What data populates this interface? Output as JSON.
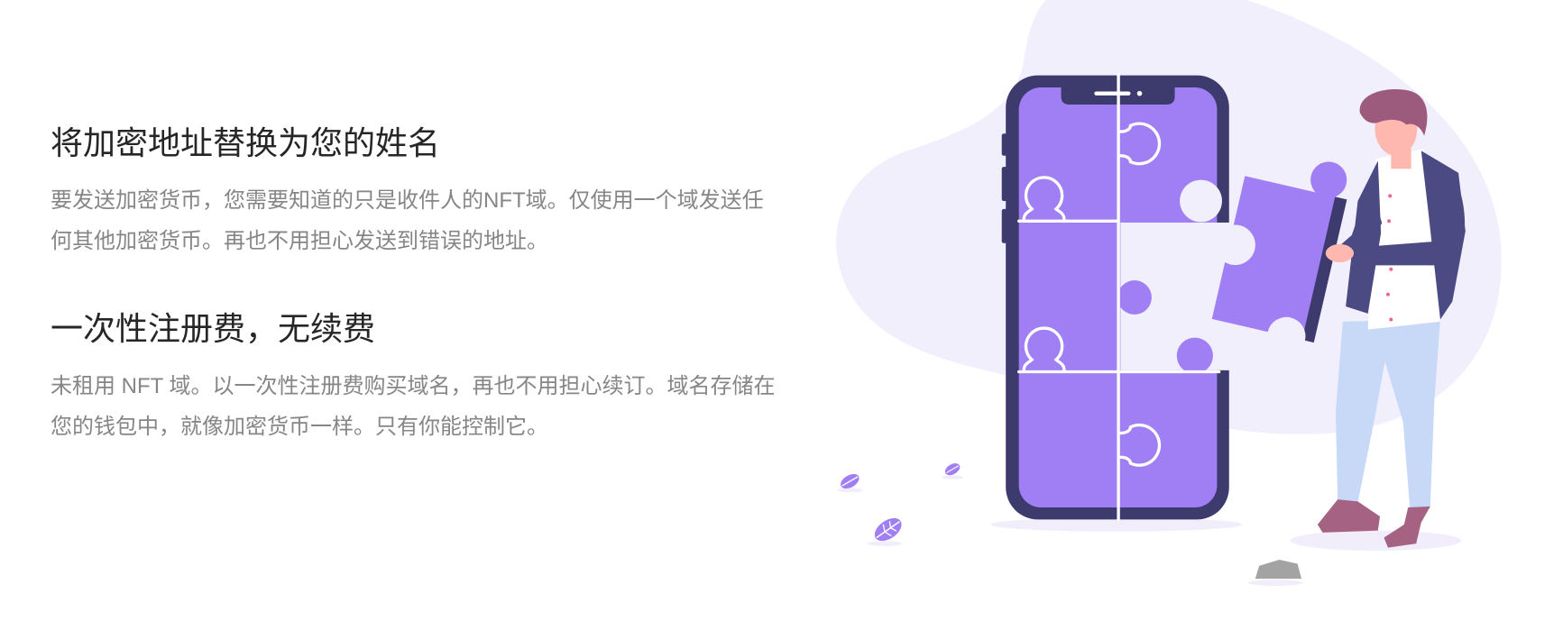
{
  "features": [
    {
      "title": "将加密地址替换为您的姓名",
      "lines": [
        "要发送加密货币，您需要知道的只是收件人的NFT域。仅使用一个域发送任",
        "何其他加密货币。再也不用担心发送到错误的地址。"
      ]
    },
    {
      "title": "一次性注册费，无续费",
      "lines": [
        "未租用 NFT 域。以一次性注册费购买域名，再也不用担心续订。域名存储在",
        "您的钱包中，就像加密货币一样。只有你能控制它。"
      ]
    }
  ],
  "colors": {
    "heading": "#262626",
    "body_text": "#868686",
    "blob": "#f2effc",
    "phone": "#3d3a6e",
    "purple": "#a07ff5",
    "hair": "#9c5b7d",
    "skin": "#ffb8b0",
    "jacket": "#4b4a82",
    "pants": "#c7d9f6",
    "shoes": "#a56282",
    "rock": "#a3a3a3",
    "shirt_dots": "#f06292"
  },
  "illustration": {
    "subject": "person-placing-puzzle-piece-into-phone"
  }
}
